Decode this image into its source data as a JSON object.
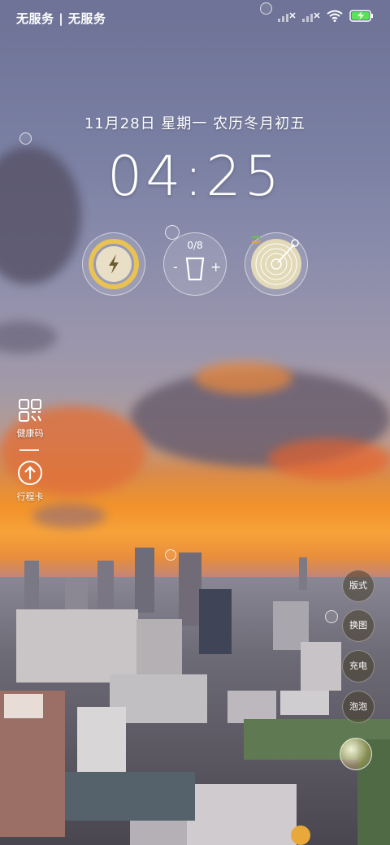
{
  "status_bar": {
    "carrier": "无服务 | 无服务",
    "icons": [
      "signal-no-service-icon",
      "signal-no-service-icon",
      "wifi-icon",
      "battery-charging-icon"
    ]
  },
  "lock": {
    "date_line": "11月28日 星期一 农历冬月初五",
    "time": "04:25"
  },
  "widgets": {
    "charge": {
      "icon": "lightning-icon"
    },
    "water": {
      "count": "0/8",
      "minus": "-",
      "plus": "+",
      "icon": "cup-icon"
    },
    "music": {
      "icon": "vinyl-record-icon"
    }
  },
  "side_shortcuts": [
    {
      "label": "健康码",
      "icon": "qr-code-icon"
    },
    {
      "label": "行程卡",
      "icon": "upload-arrow-icon"
    }
  ],
  "right_buttons": [
    {
      "label": "版式"
    },
    {
      "label": "换图"
    },
    {
      "label": "充电"
    },
    {
      "label": "泡泡"
    }
  ],
  "colors": {
    "sky_top": "#6d7296",
    "sunset_orange": "#f2922a",
    "accent_green": "#59e35a"
  }
}
